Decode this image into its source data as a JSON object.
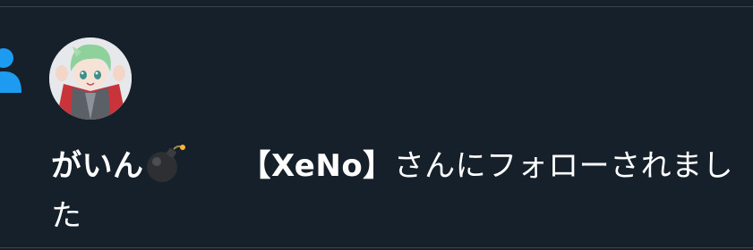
{
  "notification": {
    "type": "follow",
    "icon": "person-icon",
    "avatar": "user-avatar-anime-character",
    "user_name": "がいん",
    "name_emoji": "bomb-icon",
    "account_name": "【XeNo】",
    "message_suffix": "さんにフォローされました"
  },
  "colors": {
    "background": "#15202b",
    "text": "#ffffff",
    "accent": "#1d9bf0",
    "divider": "#38444d"
  }
}
